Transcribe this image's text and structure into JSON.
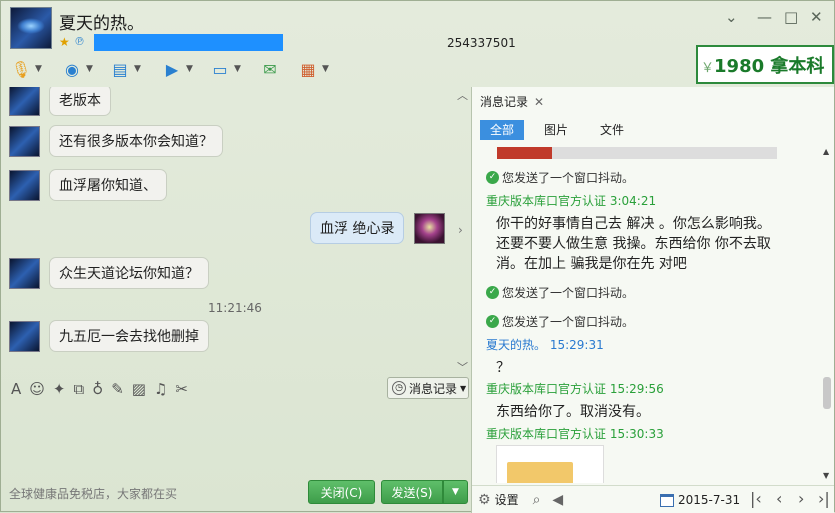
{
  "window": {
    "contact_name": "夏天的热。",
    "qq_number": "254337501",
    "controls": [
      "chevron-down",
      "minimize",
      "maximize",
      "close"
    ]
  },
  "ad_banner": {
    "prefix": "￥",
    "text": "1980 拿本科"
  },
  "toolbar_icons": [
    "microphone-icon",
    "webcam-icon",
    "screen-share-icon",
    "file-transfer-icon",
    "remote-desktop-icon",
    "chat-add-icon",
    "apps-icon"
  ],
  "chat": {
    "messages": [
      {
        "side": "left",
        "text": "老版本"
      },
      {
        "side": "left",
        "text": "还有很多版本你会知道？"
      },
      {
        "side": "left",
        "text": "血浮屠你知道、"
      },
      {
        "side": "right",
        "text": "血浮  绝心录"
      },
      {
        "side": "left",
        "text": "众生天道论坛你知道？"
      },
      {
        "side": "left",
        "text": "九五厄一会去找他删掉"
      }
    ],
    "timestamp": "11:21:46"
  },
  "input_toolbar": {
    "record_button": "消息记录"
  },
  "footer": {
    "ad_text": "全球健康品免税店，大家都在买",
    "close_button": "关闭(C)",
    "send_button": "发送(S)"
  },
  "history": {
    "tab_label": "消息记录",
    "filters": [
      "全部",
      "图片",
      "文件"
    ],
    "active_filter": "全部",
    "records": [
      {
        "type": "system",
        "text": "您发送了一个窗口抖动。"
      },
      {
        "type": "header",
        "name": "重庆版本库口官方认证",
        "time": "3:04:21",
        "color": "#2aa03a"
      },
      {
        "type": "text",
        "lines": [
          "你干的好事情自己去 解决 。你怎么影响我。",
          "还要不要人做生意 我操。东西给你 你不去取",
          "消。在加上 骗我是你在先 对吧"
        ]
      },
      {
        "type": "system",
        "text": "您发送了一个窗口抖动。"
      },
      {
        "type": "system",
        "text": "您发送了一个窗口抖动。"
      },
      {
        "type": "header",
        "name": "夏天的热。",
        "time": "15:29:31",
        "color": "#2a7ad0"
      },
      {
        "type": "text",
        "lines": [
          "？"
        ]
      },
      {
        "type": "header",
        "name": "重庆版本库口官方认证",
        "time": "15:29:56",
        "color": "#2aa03a"
      },
      {
        "type": "text",
        "lines": [
          "东西给你了。取消没有。"
        ]
      },
      {
        "type": "header",
        "name": "重庆版本库口官方认证",
        "time": "15:30:33",
        "color": "#2aa03a"
      }
    ],
    "settings_label": "设置",
    "date": "2015-7-31"
  }
}
